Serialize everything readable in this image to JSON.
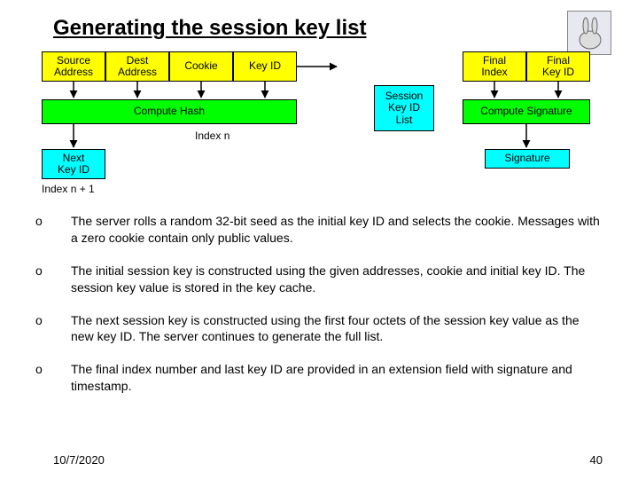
{
  "title": "Generating the session key list",
  "boxes": {
    "source_address": "Source\nAddress",
    "dest_address": "Dest\nAddress",
    "cookie": "Cookie",
    "key_id": "Key ID",
    "compute_hash": "Compute Hash",
    "next_key_id": "Next\nKey ID",
    "session_key_id_list": "Session\nKey ID\nList",
    "final_index": "Final\nIndex",
    "final_key_id": "Final\nKey ID",
    "compute_signature": "Compute Signature",
    "signature": "Signature"
  },
  "labels": {
    "index_n": "Index n",
    "index_n_plus_1": "Index n + 1"
  },
  "bullets": [
    "The server rolls a random 32-bit seed as the initial key ID and selects the cookie. Messages with a zero cookie contain only public values.",
    "The initial session key is constructed using the given addresses, cookie and initial key ID. The session key value is stored in the key cache.",
    "The next session key is constructed using the first four octets of the session key value as the new key ID. The server continues to generate the full list.",
    "The final index number and last key ID are provided in an extension field with signature and timestamp."
  ],
  "footer": {
    "date": "10/7/2020",
    "page": "40"
  }
}
